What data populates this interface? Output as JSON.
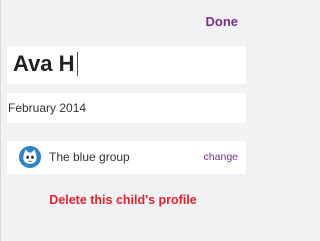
{
  "header": {
    "done_label": "Done"
  },
  "profile": {
    "name_value": "Ava H",
    "birth_date": "February 2014"
  },
  "group": {
    "name": "The blue group",
    "change_label": "change",
    "avatar_icon": "cat-face-icon",
    "avatar_color": "#2d84c4"
  },
  "actions": {
    "delete_label": "Delete this child's profile"
  },
  "colors": {
    "accent": "#7b2f8c",
    "danger": "#e5232b",
    "background": "#f2f2f4"
  }
}
